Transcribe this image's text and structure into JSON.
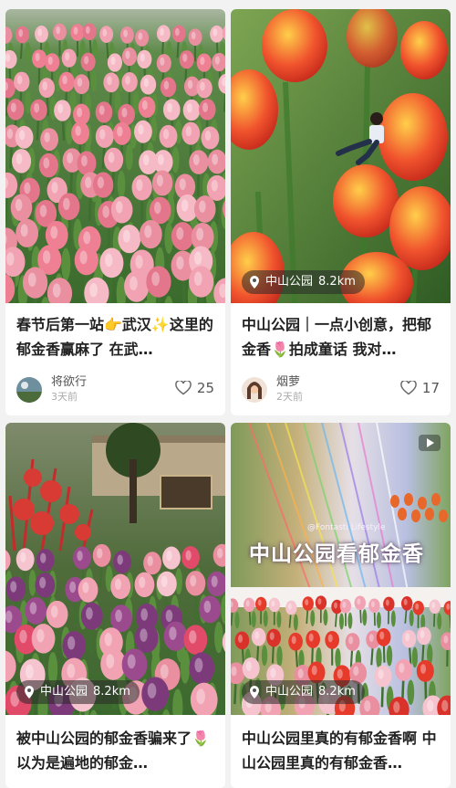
{
  "cards": [
    {
      "title": "春节后第一站👉武汉✨这里的郁金香赢麻了 在武…",
      "author": "将欲行",
      "time": "3天前",
      "likes": "25"
    },
    {
      "location": "中山公园",
      "distance": "8.2km",
      "title": "中山公园｜一点小创意，把郁金香🌷拍成童话 我对…",
      "author": "烟萝",
      "time": "2天前",
      "likes": "17"
    },
    {
      "location": "中山公园",
      "distance": "8.2km",
      "title": "被中山公园的郁金香骗来了🌷以为是遍地的郁金…"
    },
    {
      "location": "中山公园",
      "distance": "8.2km",
      "overlay_text": "中山公园看郁金香",
      "watermark": "@Fontasti Lifestyle",
      "title": "中山公园里真的有郁金香啊 中山公园里真的有郁金香…"
    }
  ],
  "colors": {
    "pink_tulip": "#e98fa0",
    "red_tulip": "#e63a2a",
    "leaf_green": "#4f7d3a",
    "background": "#f2f2f2"
  },
  "icons": [
    "location-pin-icon",
    "heart-icon",
    "play-icon"
  ]
}
